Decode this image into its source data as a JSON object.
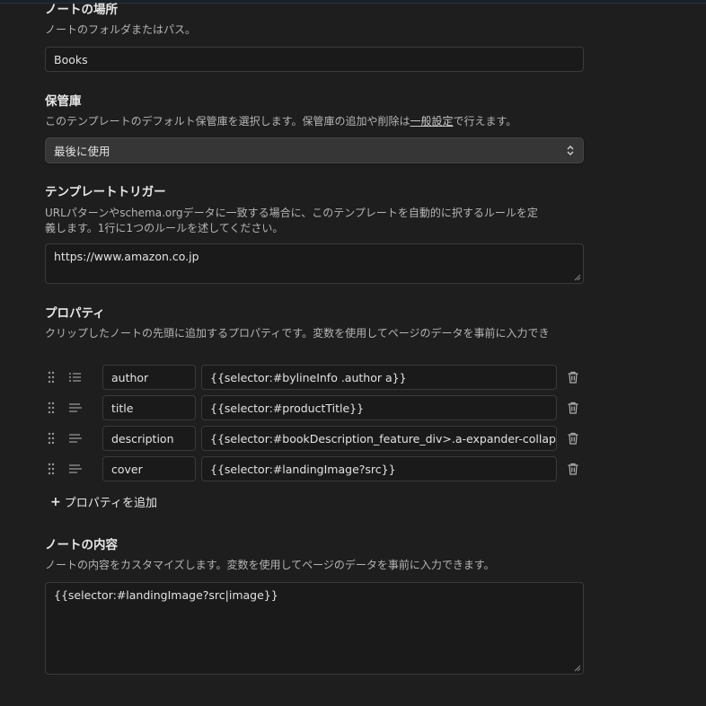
{
  "note_location": {
    "title": "ノートの場所",
    "description": "ノートのフォルダまたはパス。",
    "value": "Books"
  },
  "vault": {
    "title": "保管庫",
    "description_before": "このテンプレートのデフォルト保管庫を選択します。保管庫の追加や削除は",
    "description_link": "一般設定",
    "description_after": "で行えます。",
    "selected": "最後に使用"
  },
  "triggers": {
    "title": "テンプレートトリガー",
    "description_line1": "URLパターンやschema.orgデータに一致する場合に、このテンプレートを自動的に択するルールを定",
    "description_line2": "義します。1行に1つのルールを述してください。",
    "value": "https://www.amazon.co.jp"
  },
  "properties": {
    "title": "プロパティ",
    "description": "クリップしたノートの先頭に追加するプロパティです。変数を使用してページのデータを事前に入力でき",
    "items": [
      {
        "type_icon": "list-icon",
        "key": "author",
        "value": "{{selector:#bylineInfo .author a}}"
      },
      {
        "type_icon": "text-icon",
        "key": "title",
        "value": "{{selector:#productTitle}}"
      },
      {
        "type_icon": "text-icon",
        "key": "description",
        "value": "{{selector:#bookDescription_feature_div>.a-expander-collapsed"
      },
      {
        "type_icon": "text-icon",
        "key": "cover",
        "value": "{{selector:#landingImage?src}}"
      }
    ],
    "add_label": "プロパティを追加",
    "add_icon": "+"
  },
  "note_content": {
    "title": "ノートの内容",
    "description": "ノートの内容をカスタマイズします。変数を使用してページのデータを事前に入力できます。",
    "value": "{{selector:#landingImage?src|image}}"
  }
}
